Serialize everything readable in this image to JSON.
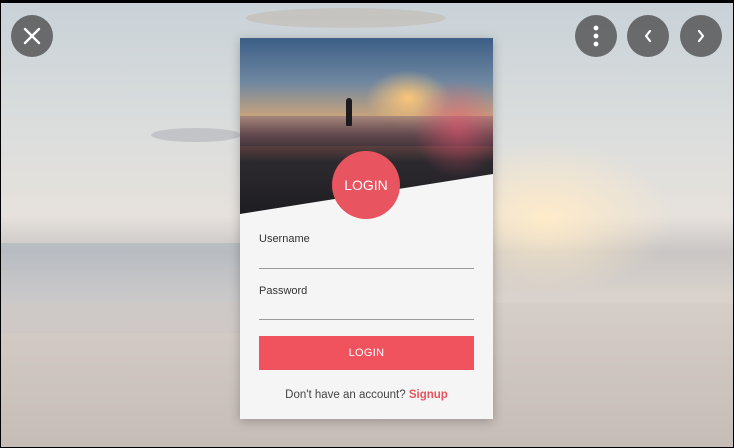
{
  "toolbar": {
    "close_icon": "close-icon",
    "more_icon": "more-vertical-icon",
    "prev_icon": "chevron-left-icon",
    "next_icon": "chevron-right-icon"
  },
  "card": {
    "circle_title": "LOGIN",
    "username_label": "Username",
    "username_value": "",
    "password_label": "Password",
    "password_value": "",
    "submit_label": "LOGIN",
    "signup_prompt": "Don't have an account?",
    "signup_link": "Signup"
  },
  "colors": {
    "accent": "#e8545f",
    "button": "#f0535d",
    "card_background": "#f5f5f5"
  }
}
